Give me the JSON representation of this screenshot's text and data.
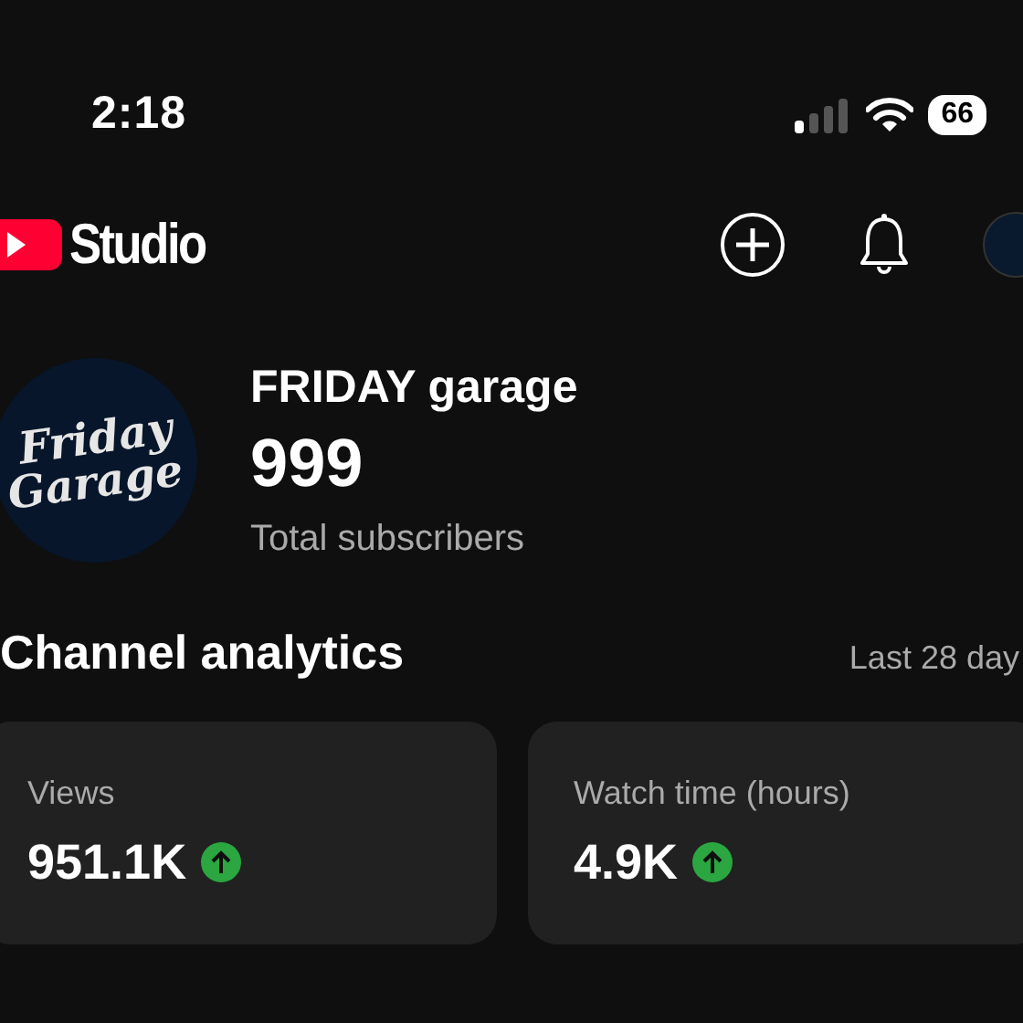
{
  "status_bar": {
    "time": "2:18",
    "battery": "66"
  },
  "header": {
    "title": "Studio"
  },
  "channel": {
    "avatar_text": [
      "Friday",
      "Garage"
    ],
    "name": "FRIDAY garage",
    "subscribers": "999",
    "subscribers_label": "Total subscribers"
  },
  "analytics": {
    "title": "Channel analytics",
    "period": "Last 28 day",
    "cards": [
      {
        "label": "Views",
        "value": "951.1K",
        "rising": true
      },
      {
        "label": "Watch time (hours)",
        "value": "4.9K",
        "rising": true
      }
    ]
  }
}
